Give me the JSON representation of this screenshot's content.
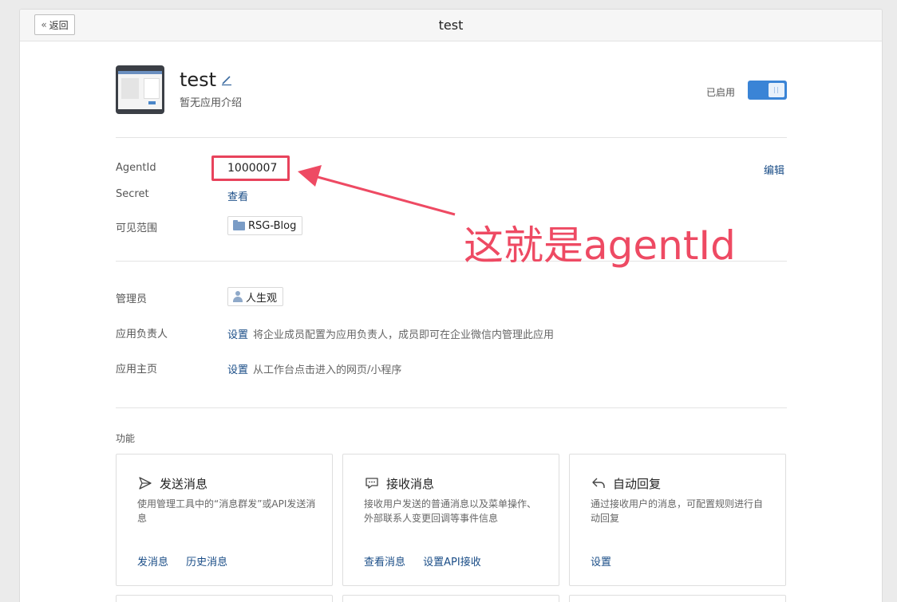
{
  "header": {
    "back_label": "返回",
    "title": "test"
  },
  "app": {
    "name": "test",
    "description": "暂无应用介绍",
    "status_label": "已启用",
    "enabled": true
  },
  "info": {
    "agentid_label": "AgentId",
    "agentid_value": "1000007",
    "edit_label": "编辑",
    "secret_label": "Secret",
    "secret_link": "查看",
    "visibility_label": "可见范围",
    "visibility_tag": "RSG-Blog"
  },
  "admin": {
    "admin_label": "管理员",
    "admin_tag": "人生观",
    "owner_label": "应用负责人",
    "owner_link": "设置",
    "owner_hint": "将企业成员配置为应用负责人，成员即可在企业微信内管理此应用",
    "homepage_label": "应用主页",
    "homepage_link": "设置",
    "homepage_hint": "从工作台点击进入的网页/小程序"
  },
  "annotation": {
    "text": "这就是agentId",
    "color": "#ee4a63"
  },
  "features": {
    "section_label": "功能",
    "cards": [
      {
        "icon": "send-icon",
        "title": "发送消息",
        "desc": "使用管理工具中的“消息群发”或API发送消息",
        "links": [
          "发消息",
          "历史消息"
        ]
      },
      {
        "icon": "chat-icon",
        "title": "接收消息",
        "desc": "接收用户发送的普通消息以及菜单操作、外部联系人变更回调等事件信息",
        "links": [
          "查看消息",
          "设置API接收"
        ]
      },
      {
        "icon": "reply-icon",
        "title": "自动回复",
        "desc": "通过接收用户的消息，可配置规则进行自动回复",
        "links": [
          "设置"
        ]
      }
    ]
  },
  "colors": {
    "link": "#1a4d87",
    "accent": "#3a84d6",
    "highlight": "#e8435c"
  }
}
